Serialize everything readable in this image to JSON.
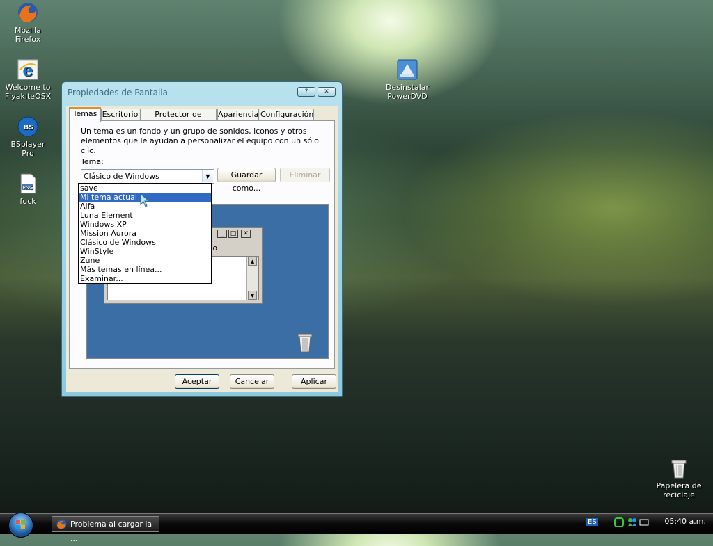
{
  "desktop": {
    "icons": [
      {
        "label_1": "Mozilla",
        "label_2": "Firefox"
      },
      {
        "label_1": "Welcome to",
        "label_2": "FlyakiteOSX"
      },
      {
        "label_1": "BSplayer",
        "label_2": "Pro"
      },
      {
        "label_1": "fuck",
        "label_2": ""
      },
      {
        "label_1": "Desinstalar",
        "label_2": "PowerDVD"
      },
      {
        "label_1": "Papelera de",
        "label_2": "reciclaje"
      }
    ],
    "png_badge": "PNG",
    "bs_badge": "BS"
  },
  "window": {
    "title": "Propiedades de Pantalla",
    "help_btn": "?",
    "close_btn": "✕",
    "tabs": [
      "Temas",
      "Escritorio",
      "Protector de pantalla",
      "Apariencia",
      "Configuración"
    ],
    "description": "Un tema es un fondo y un grupo de sonidos, iconos y otros elementos que le ayudan a personalizar el equipo con un sólo clic.",
    "tema_label": "Tema:",
    "tema_value": "Clásico de Windows",
    "save_as": "Guardar como...",
    "delete": "Eliminar",
    "preview_text": "onado",
    "dropdown_items": [
      "save",
      "Mi tema actual",
      "Alfa",
      "Luna Element",
      "Windows XP",
      "Mission Aurora",
      "Clásico de Windows",
      "WinStyle",
      "Zune",
      "Más temas en línea...",
      "Examinar..."
    ],
    "selected_index": 1,
    "ok": "Aceptar",
    "cancel": "Cancelar",
    "apply": "Aplicar"
  },
  "taskbar": {
    "task_label": "Problema al cargar la ...",
    "lang": "ES",
    "clock": "05:40 a.m."
  },
  "colors": {
    "selection": "#316ac5",
    "preview_bg": "#3a6ea5",
    "tab_accent": "#e68b2c"
  }
}
